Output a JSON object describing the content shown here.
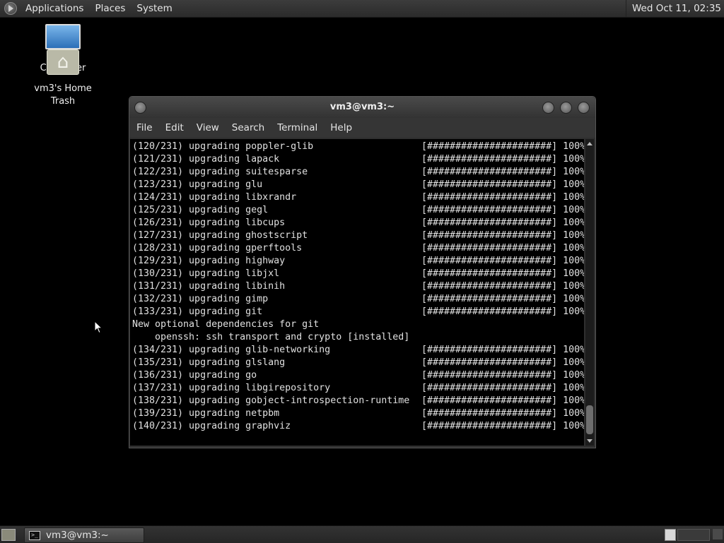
{
  "top_panel": {
    "menus": [
      "Applications",
      "Places",
      "System"
    ],
    "clock": "Wed Oct 11, 02:35"
  },
  "desktop": {
    "icons": [
      {
        "label": "Computer",
        "icon": "computer-icon"
      },
      {
        "label": "vm3's Home",
        "icon": "home-folder-icon"
      },
      {
        "label": "Trash",
        "icon": "trash-icon"
      }
    ]
  },
  "terminal": {
    "title": "vm3@vm3:~",
    "menu": [
      "File",
      "Edit",
      "View",
      "Search",
      "Terminal",
      "Help"
    ],
    "progress_bar": "[######################]",
    "lines": [
      {
        "text": "(120/231) upgrading poppler-glib",
        "progress": "100%"
      },
      {
        "text": "(121/231) upgrading lapack",
        "progress": "100%"
      },
      {
        "text": "(122/231) upgrading suitesparse",
        "progress": "100%"
      },
      {
        "text": "(123/231) upgrading glu",
        "progress": "100%"
      },
      {
        "text": "(124/231) upgrading libxrandr",
        "progress": "100%"
      },
      {
        "text": "(125/231) upgrading gegl",
        "progress": "100%"
      },
      {
        "text": "(126/231) upgrading libcups",
        "progress": "100%"
      },
      {
        "text": "(127/231) upgrading ghostscript",
        "progress": "100%"
      },
      {
        "text": "(128/231) upgrading gperftools",
        "progress": "100%"
      },
      {
        "text": "(129/231) upgrading highway",
        "progress": "100%"
      },
      {
        "text": "(130/231) upgrading libjxl",
        "progress": "100%"
      },
      {
        "text": "(131/231) upgrading libinih",
        "progress": "100%"
      },
      {
        "text": "(132/231) upgrading gimp",
        "progress": "100%"
      },
      {
        "text": "(133/231) upgrading git",
        "progress": "100%"
      },
      {
        "text": "New optional dependencies for git",
        "progress": null
      },
      {
        "text": "    openssh: ssh transport and crypto [installed]",
        "progress": null
      },
      {
        "text": "(134/231) upgrading glib-networking",
        "progress": "100%"
      },
      {
        "text": "(135/231) upgrading glslang",
        "progress": "100%"
      },
      {
        "text": "(136/231) upgrading go",
        "progress": "100%"
      },
      {
        "text": "(137/231) upgrading libgirepository",
        "progress": "100%"
      },
      {
        "text": "(138/231) upgrading gobject-introspection-runtime",
        "progress": "100%"
      },
      {
        "text": "(139/231) upgrading netpbm",
        "progress": "100%"
      },
      {
        "text": "(140/231) upgrading graphviz",
        "progress": "100%"
      }
    ],
    "scrollbar": {
      "thumb_start": 0.89,
      "thumb_size": 0.1
    }
  },
  "taskbar": {
    "windows": [
      {
        "label": "vm3@vm3:~",
        "icon": "terminal-icon"
      }
    ]
  }
}
